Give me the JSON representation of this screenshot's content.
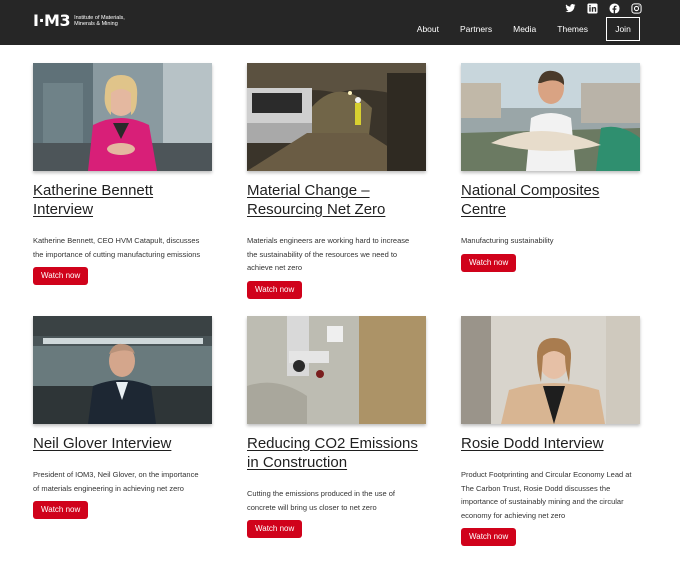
{
  "header": {
    "logo_mark": "I·M3",
    "logo_text_line1": "Institute of Materials,",
    "logo_text_line2": "Minerals & Mining",
    "socials": [
      "twitter-icon",
      "linkedin-icon",
      "facebook-icon",
      "instagram-icon"
    ],
    "nav": [
      "About",
      "Partners",
      "Media",
      "Themes"
    ],
    "join": "Join"
  },
  "colors": {
    "header_bg": "#262626",
    "button_red": "#d0021b"
  },
  "cards": [
    {
      "title": "Katherine Bennett Interview",
      "desc": "Katherine Bennett, CEO HVM Catapult, discusses the importance of cutting manufacturing emissions",
      "button": "Watch now"
    },
    {
      "title": "Material Change – Resourcing Net Zero",
      "desc": "Materials engineers are working hard to increase the sustainability of the resources we need to achieve net zero",
      "button": "Watch now"
    },
    {
      "title": "National Composites Centre",
      "desc": "Manufacturing sustainability",
      "button": "Watch now"
    },
    {
      "title": "Neil Glover Interview",
      "desc": "President of IOM3, Neil Glover, on the importance of materials engineering in achieving net zero",
      "button": "Watch now"
    },
    {
      "title": "Reducing CO2 Emissions in Construction",
      "desc": "Cutting the emissions produced in the use of concrete will bring us closer to net zero",
      "button": "Watch now"
    },
    {
      "title": "Rosie Dodd Interview",
      "desc": "Product Footprinting and Circular Economy Lead at The Carbon Trust, Rosie Dodd discusses the importance of sustainably mining and the circular economy for achieving net zero",
      "button": "Watch now"
    }
  ]
}
